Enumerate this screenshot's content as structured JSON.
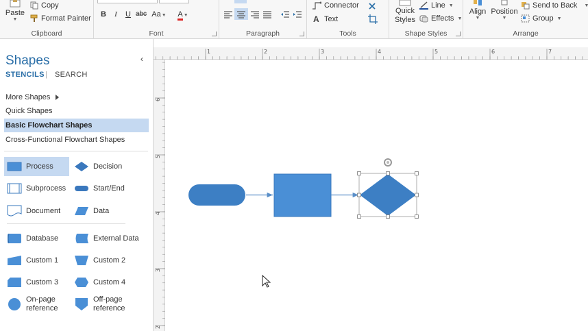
{
  "ribbon": {
    "clipboard": {
      "paste_label": "Paste",
      "copy_label": "Copy",
      "format_painter_label": "Format Painter",
      "group_label": "Clipboard"
    },
    "font": {
      "bold": "B",
      "italic": "I",
      "underline": "U",
      "strikethrough": "abc",
      "font_size": "Aa",
      "font_color": "A",
      "group_label": "Font"
    },
    "paragraph": {
      "group_label": "Paragraph"
    },
    "tools": {
      "connector_label": "Connector",
      "text_label": "Text",
      "group_label": "Tools"
    },
    "shape_styles": {
      "quick_styles_label": "Quick\nStyles",
      "line_label": "Line",
      "effects_label": "Effects",
      "group_label": "Shape Styles"
    },
    "arrange": {
      "align_label": "Align",
      "position_label": "Position",
      "send_to_back_label": "Send to Back",
      "group_btn_label": "Group",
      "group_label": "Arrange"
    }
  },
  "shapes_pane": {
    "title": "Shapes",
    "tabs": {
      "stencils": "STENCILS",
      "separator": "|",
      "search": "SEARCH"
    },
    "stencils": [
      {
        "label": "More Shapes"
      },
      {
        "label": "Quick Shapes"
      },
      {
        "label": "Basic Flowchart Shapes",
        "selected": true
      },
      {
        "label": "Cross-Functional Flowchart Shapes"
      }
    ],
    "shapes": [
      {
        "label": "Process",
        "icon": "process-shape-icon",
        "selected": true
      },
      {
        "label": "Decision",
        "icon": "decision-shape-icon"
      },
      {
        "label": "Subprocess",
        "icon": "subprocess-shape-icon"
      },
      {
        "label": "Start/End",
        "icon": "start-end-shape-icon"
      },
      {
        "label": "Document",
        "icon": "document-shape-icon"
      },
      {
        "label": "Data",
        "icon": "data-shape-icon"
      },
      {
        "label": "Database",
        "icon": "database-shape-icon"
      },
      {
        "label": "External Data",
        "icon": "external-data-shape-icon"
      },
      {
        "label": "Custom 1",
        "icon": "custom-1-shape-icon"
      },
      {
        "label": "Custom 2",
        "icon": "custom-2-shape-icon"
      },
      {
        "label": "Custom 3",
        "icon": "custom-3-shape-icon"
      },
      {
        "label": "Custom 4",
        "icon": "custom-4-shape-icon"
      },
      {
        "label": "On-page\nreference",
        "icon": "on-page-reference-shape-icon"
      },
      {
        "label": "Off-page\nreference",
        "icon": "off-page-reference-shape-icon"
      }
    ]
  },
  "rulers": {
    "top_numbers": [
      "1",
      "2",
      "3",
      "4",
      "5",
      "6",
      "7"
    ],
    "left_numbers": [
      "6",
      "5",
      "4",
      "3",
      "2"
    ]
  },
  "colors": {
    "shape_fill": "#4a8fd6",
    "shape_dark": "#3a78bd",
    "connector": "#5a8fc8",
    "selection": "#888888",
    "accent": "#2b6fa8",
    "selected_bg": "#c5d9f1"
  }
}
